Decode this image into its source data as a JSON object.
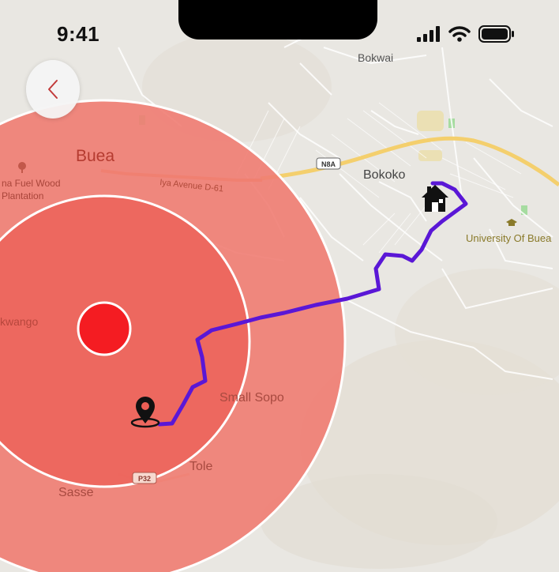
{
  "status_bar": {
    "time": "9:41"
  },
  "map": {
    "places": {
      "bokwai": "Bokwai",
      "buea": "Buea",
      "bokoko": "Bokoko",
      "fuel_wood_1": "na Fuel Wood",
      "fuel_wood_2": "Plantation",
      "university": "University Of Buea",
      "kwango": "kwango",
      "small_sopo": "Small Sopo",
      "tole": "Tole",
      "sasse": "Sasse",
      "sopo_partial": "SMALL SOPO"
    },
    "roads": {
      "iya_avenue": "Iya Avenue D-61",
      "n8a": "N8A",
      "p32": "P32"
    },
    "colors": {
      "route": "#5a17d6",
      "zone_outer": "#f07c72",
      "zone_inner": "#ec5e55",
      "zone_center": "#f41c22",
      "highway": "#f4cf6d"
    }
  },
  "icons": {
    "back": "chevron-left-icon",
    "home": "house-icon",
    "origin": "location-pin-icon"
  }
}
